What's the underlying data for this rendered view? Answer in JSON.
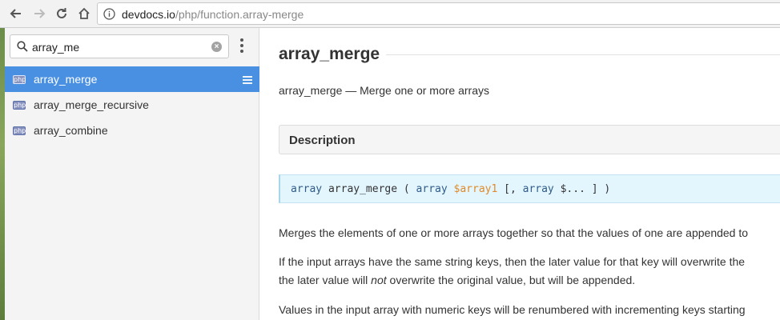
{
  "browser": {
    "url_host": "devdocs.io",
    "url_path": "/php/function.array-merge"
  },
  "sidebar": {
    "search_value": "array_me",
    "results": [
      {
        "badge": "php",
        "label": "array_merge",
        "active": true
      },
      {
        "badge": "php",
        "label": "array_merge_recursive",
        "active": false
      },
      {
        "badge": "php",
        "label": "array_combine",
        "active": false
      }
    ]
  },
  "main": {
    "title": "array_merge",
    "subtitle": "array_merge — Merge one or more arrays",
    "section_heading": "Description",
    "signature": {
      "t1": "array",
      "fn": " array_merge ( ",
      "t2": "array",
      "v1": " $array1",
      "mid": " [, ",
      "t3": "array",
      "rest": " $... ] )"
    },
    "para1": "Merges the elements of one or more arrays together so that the values of one are appended to",
    "para2_line1": "If the input arrays have the same string keys, then the later value for that key will overwrite the",
    "para2_line2_a": "the later value will ",
    "para2_line2_em": "not",
    "para2_line2_b": " overwrite the original value, but will be appended.",
    "para3": "Values in the input array with numeric keys will be renumbered with incrementing keys starting"
  }
}
